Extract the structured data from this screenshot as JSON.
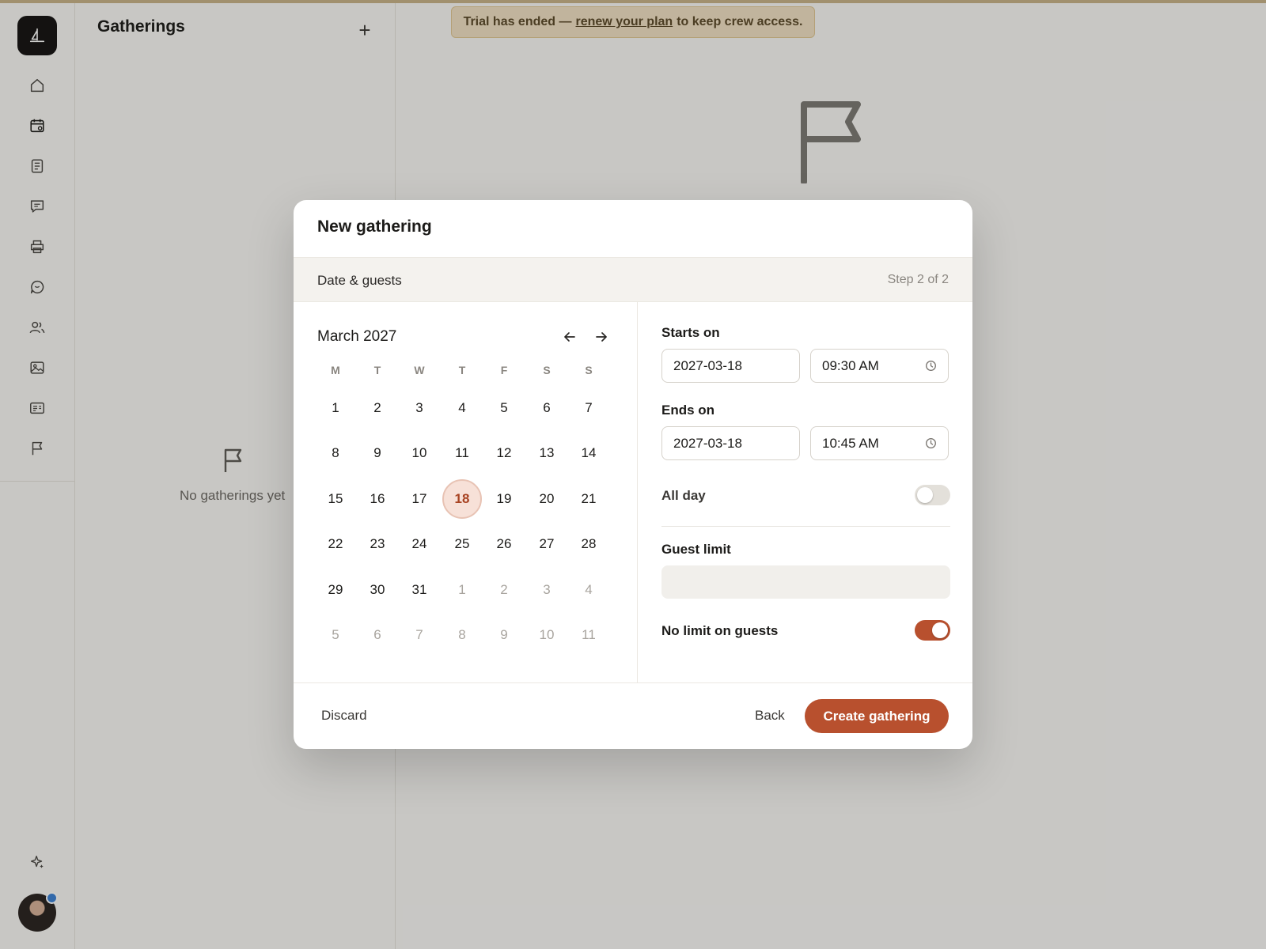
{
  "banner": {
    "prefix": "Trial has ended —",
    "link": "renew your plan",
    "suffix": "to keep crew access."
  },
  "rail": {
    "items": [
      {
        "icon": "home-icon"
      },
      {
        "icon": "calendar-icon"
      },
      {
        "icon": "document-icon"
      },
      {
        "icon": "message-square-icon"
      },
      {
        "icon": "printer-icon"
      },
      {
        "icon": "chat-bubble-icon"
      },
      {
        "icon": "users-icon"
      },
      {
        "icon": "image-icon"
      },
      {
        "icon": "id-card-icon"
      },
      {
        "icon": "flag-icon"
      }
    ],
    "bottom_icon": "sparkle-icon"
  },
  "list_panel": {
    "title": "Gatherings",
    "add_label": "+",
    "empty_text": "No gatherings yet"
  },
  "modal": {
    "title": "New gathering",
    "step_label": "Date & guests",
    "step_count": "Step 2 of 2",
    "calendar": {
      "month_label": "March 2027",
      "weekdays": [
        "M",
        "T",
        "W",
        "T",
        "F",
        "S",
        "S"
      ],
      "weeks": [
        [
          "1",
          "2",
          "3",
          "4",
          "5",
          "6",
          "7"
        ],
        [
          "8",
          "9",
          "10",
          "11",
          "12",
          "13",
          "14"
        ],
        [
          "15",
          "16",
          "17",
          "18",
          "19",
          "20",
          "21"
        ],
        [
          "22",
          "23",
          "24",
          "25",
          "26",
          "27",
          "28"
        ],
        [
          "29",
          "30",
          "31",
          "1",
          "2",
          "3",
          "4"
        ],
        [
          "5",
          "6",
          "7",
          "8",
          "9",
          "10",
          "11"
        ]
      ],
      "selected_day": "18"
    },
    "starts_label": "Starts on",
    "starts_date": "2027-03-18",
    "starts_time": "09:30 AM",
    "ends_label": "Ends on",
    "ends_date": "2027-03-18",
    "ends_time": "10:45 AM",
    "all_day_label": "All day",
    "all_day_on": false,
    "guest_limit_label": "Guest limit",
    "guest_limit_value": "",
    "no_limit_label": "No limit on guests",
    "no_limit_on": true,
    "discard_label": "Discard",
    "back_label": "Back",
    "create_label": "Create gathering"
  },
  "colors": {
    "accent": "#b8502e",
    "selected_day_bg": "#f7e1d8",
    "banner_bg": "#f3e2c6"
  }
}
